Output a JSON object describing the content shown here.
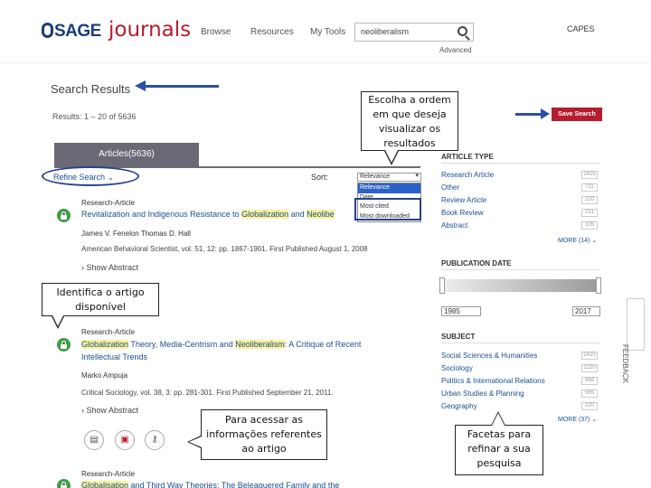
{
  "header": {
    "logo_sage": "SAGE",
    "logo_journals": "journals",
    "nav": [
      "Browse",
      "Resources",
      "My Tools"
    ],
    "search_value": "neoliberalism",
    "advanced_label": "Advanced",
    "institution": "CAPES"
  },
  "main": {
    "title": "Search Results",
    "results_count": "Results: 1 – 20 of 5636",
    "tab_label": "Articles(5636)",
    "refine_label": "Refine Search",
    "sort_label": "Sort:",
    "sort_selected": "Relevance",
    "sort_options": [
      "Relevance",
      "Date",
      "Most cited",
      "Most downloaded"
    ],
    "save_search_label": "Save Search",
    "feedback_label": "FEEDBACK"
  },
  "results": [
    {
      "type": "Research-Article",
      "title_parts": [
        "Revitalization and Indigenous Resistance to ",
        "Globalization",
        " and ",
        "Neolibe"
      ],
      "authors": "James V. Fenelon   Thomas D. Hall",
      "meta": "American Behavioral Scientist, vol. 51, 12: pp. 1867-1901. First Published August 1, 2008",
      "show_abstract": "› Show Abstract"
    },
    {
      "type": "Research-Article",
      "title_line1_parts": [
        "Globalization",
        " Theory, Media-Centrism and ",
        "Neoliberalism",
        ": A Critique of Recent"
      ],
      "title_line2": "Intellectual Trends",
      "authors": "Marko Ampuja",
      "meta": "Critical Sociology, vol. 38, 3: pp. 281-301. First Published September 21, 2011.",
      "show_abstract": "› Show Abstract"
    },
    {
      "type": "Research-Article",
      "title_parts": [
        "Globalisation",
        " and Third Way Theories: The Beleaguered Family and the"
      ]
    }
  ],
  "facets": {
    "article_type": {
      "heading": "ARTICLE TYPE",
      "items": [
        {
          "label": "Research Article",
          "count": "2425"
        },
        {
          "label": "Other",
          "count": "711"
        },
        {
          "label": "Review Article",
          "count": "220"
        },
        {
          "label": "Book Review",
          "count": "231"
        },
        {
          "label": "Abstract",
          "count": "105"
        }
      ],
      "more": "MORE (14) ⌄"
    },
    "publication_date": {
      "heading": "PUBLICATION DATE",
      "from": "1985",
      "to": "2017"
    },
    "subject": {
      "heading": "SUBJECT",
      "items": [
        {
          "label": "Social Sciences & Humanities",
          "count": "2420"
        },
        {
          "label": "Sociology",
          "count": "1220"
        },
        {
          "label": "Politics & International Relations",
          "count": "868"
        },
        {
          "label": "Urban Studies & Planning",
          "count": "565"
        },
        {
          "label": "Geography",
          "count": "220"
        }
      ],
      "more": "MORE (37) ⌄"
    }
  },
  "annotations": {
    "sort_note": "Escolha a ordem em que deseja visualizar os resultados",
    "article_note": "Identifica o artigo disponível",
    "access_note": "Para acessar as informações referentes ao artigo",
    "facets_note": "Facetas para refinar a sua pesquisa"
  },
  "colors": {
    "brand_red": "#b51c2d",
    "brand_blue": "#1a3d7c",
    "link": "#1a4f8f",
    "tab": "#6b6975",
    "annotation_arrow": "#2b4fa8",
    "open_access": "#3f9b46",
    "highlight": "#fbf29b"
  }
}
